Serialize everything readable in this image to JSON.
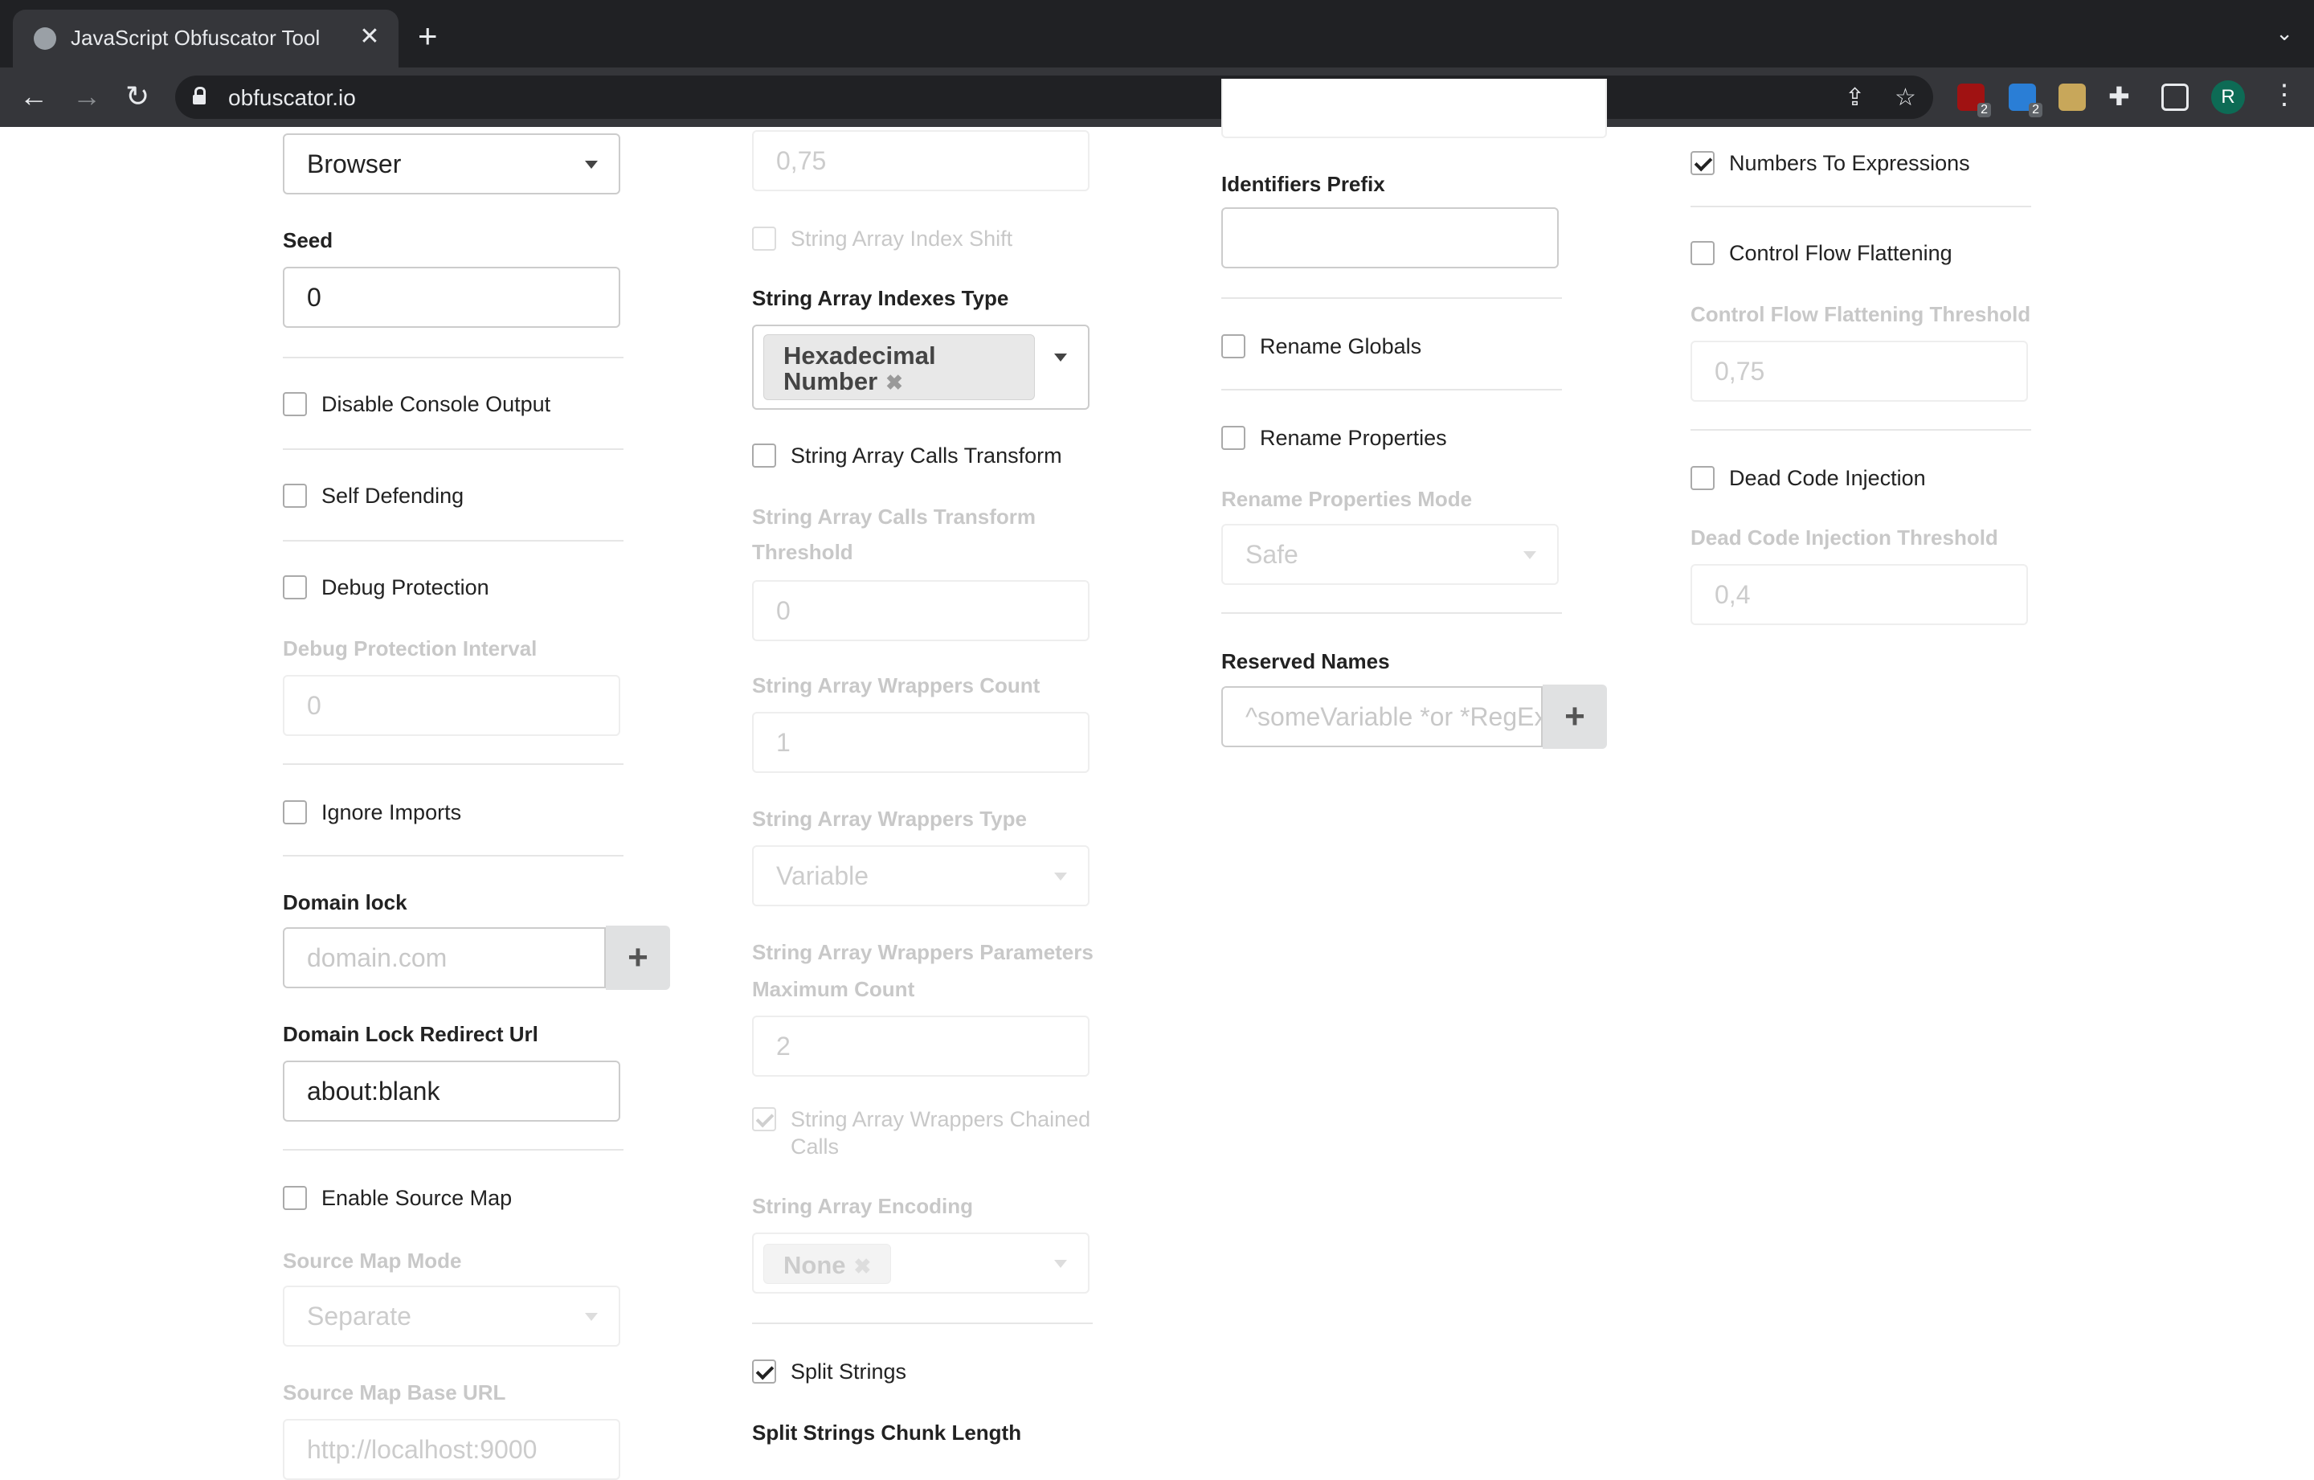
{
  "browser": {
    "tab_title": "JavaScript Obfuscator Tool",
    "tab_close": "✕",
    "new_tab": "+",
    "url": "obfuscator.io",
    "avatar_letter": "R",
    "ext_badge_1": "2",
    "ext_badge_2": "2"
  },
  "col1": {
    "target_value": "Browser",
    "seed_label": "Seed",
    "seed_value": "0",
    "disable_console": "Disable Console Output",
    "self_defending": "Self Defending",
    "debug_protection": "Debug Protection",
    "debug_interval_label": "Debug Protection Interval",
    "debug_interval_value": "0",
    "ignore_imports": "Ignore Imports",
    "domain_lock_label": "Domain lock",
    "domain_lock_placeholder": "domain.com",
    "domain_redirect_label": "Domain Lock Redirect Url",
    "domain_redirect_value": "about:blank",
    "source_map": "Enable Source Map",
    "source_map_mode_label": "Source Map Mode",
    "source_map_mode_value": "Separate",
    "source_map_base_label": "Source Map Base URL",
    "source_map_base_value": "http://localhost:9000"
  },
  "col2": {
    "top_value": "0,75",
    "index_shift": "String Array Index Shift",
    "indexes_type_label": "String Array Indexes Type",
    "indexes_type_chip_1": "Hexadecimal",
    "indexes_type_chip_2": "Number",
    "calls_transform": "String Array Calls Transform",
    "calls_threshold_label_1": "String Array Calls Transform",
    "calls_threshold_label_2": "Threshold",
    "calls_threshold_value": "0",
    "wrappers_count_label": "String Array Wrappers Count",
    "wrappers_count_value": "1",
    "wrappers_type_label": "String Array Wrappers Type",
    "wrappers_type_value": "Variable",
    "wrappers_params_label_1": "String Array Wrappers Parameters",
    "wrappers_params_label_2": "Maximum Count",
    "wrappers_params_value": "2",
    "wrappers_chained_1": "String Array Wrappers Chained",
    "wrappers_chained_2": "Calls",
    "encoding_label": "String Array Encoding",
    "encoding_chip": "None",
    "split_strings": "Split Strings",
    "chunk_length_label": "Split Strings Chunk Length"
  },
  "col3": {
    "identifiers_prefix_label": "Identifiers Prefix",
    "identifiers_prefix_value": "",
    "rename_globals": "Rename Globals",
    "rename_properties": "Rename Properties",
    "rename_mode_label": "Rename Properties Mode",
    "rename_mode_value": "Safe",
    "reserved_names_label": "Reserved Names",
    "reserved_names_placeholder": "^someVariable *or *RegExp"
  },
  "col4": {
    "numbers_to_expr": "Numbers To Expressions",
    "cff": "Control Flow Flattening",
    "cff_threshold_label": "Control Flow Flattening Threshold",
    "cff_threshold_value": "0,75",
    "dead_code": "Dead Code Injection",
    "dead_code_threshold_label": "Dead Code Injection Threshold",
    "dead_code_threshold_value": "0,4"
  },
  "colors": {
    "tabbar": "#202124",
    "toolbar": "#35363a",
    "disabled_text": "#c8c8c8"
  }
}
